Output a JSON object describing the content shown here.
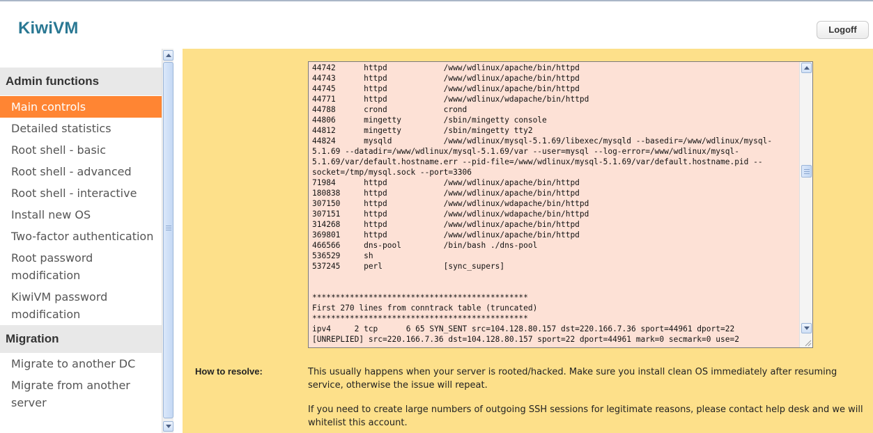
{
  "header": {
    "logo": "KiwiVM",
    "logoff_label": "Logoff"
  },
  "sidebar": {
    "sections": [
      {
        "title": "Admin functions",
        "items": [
          {
            "label": "Main controls",
            "active": true
          },
          {
            "label": "Detailed statistics"
          },
          {
            "label": "Root shell - basic"
          },
          {
            "label": "Root shell - advanced"
          },
          {
            "label": "Root shell - interactive"
          },
          {
            "label": "Install new OS"
          },
          {
            "label": "Two-factor authentication"
          },
          {
            "label": "Root password modification"
          },
          {
            "label": "KiwiVM password modification"
          }
        ]
      },
      {
        "title": "Migration",
        "items": [
          {
            "label": "Migrate to another DC"
          },
          {
            "label": "Migrate from another server"
          }
        ]
      }
    ]
  },
  "log_lines": [
    "44742      httpd            /www/wdlinux/apache/bin/httpd",
    "44743      httpd            /www/wdlinux/apache/bin/httpd",
    "44745      httpd            /www/wdlinux/apache/bin/httpd",
    "44771      httpd            /www/wdlinux/wdapache/bin/httpd",
    "44788      crond            crond",
    "44806      mingetty         /sbin/mingetty console",
    "44812      mingetty         /sbin/mingetty tty2",
    "44824      mysqld           /www/wdlinux/mysql-5.1.69/libexec/mysqld --basedir=/www/wdlinux/mysql-",
    "5.1.69 --datadir=/www/wdlinux/mysql-5.1.69/var --user=mysql --log-error=/www/wdlinux/mysql-",
    "5.1.69/var/default.hostname.err --pid-file=/www/wdlinux/mysql-5.1.69/var/default.hostname.pid --",
    "socket=/tmp/mysql.sock --port=3306",
    "71984      httpd            /www/wdlinux/apache/bin/httpd",
    "180838     httpd            /www/wdlinux/apache/bin/httpd",
    "307150     httpd            /www/wdlinux/wdapache/bin/httpd",
    "307151     httpd            /www/wdlinux/wdapache/bin/httpd",
    "314268     httpd            /www/wdlinux/apache/bin/httpd",
    "369801     httpd            /www/wdlinux/apache/bin/httpd",
    "466566     dns-pool         /bin/bash ./dns-pool",
    "536529     sh",
    "537245     perl             [sync_supers]",
    "",
    "",
    "**********************************************",
    "First 270 lines from conntrack table (truncated)",
    "**********************************************",
    "ipv4     2 tcp      6 65 SYN_SENT src=104.128.80.157 dst=220.166.7.36 sport=44961 dport=22",
    "[UNREPLIED] src=220.166.7.36 dst=104.128.80.157 sport=22 dport=44961 mark=0 secmark=0 use=2"
  ],
  "resolve": {
    "label": "How to resolve:",
    "text1": "This usually happens when your server is rooted/hacked. Make sure you install clean OS immediately after resuming service, otherwise the issue will repeat.",
    "text2": "If you need to create large numbers of outgoing SSH sessions for legitimate reasons, please contact help desk and we will whitelist this account."
  },
  "colors": {
    "accent": "#ff8533",
    "content_bg": "#fde08a",
    "log_bg": "#fde1d6",
    "logo": "#2a7893"
  }
}
